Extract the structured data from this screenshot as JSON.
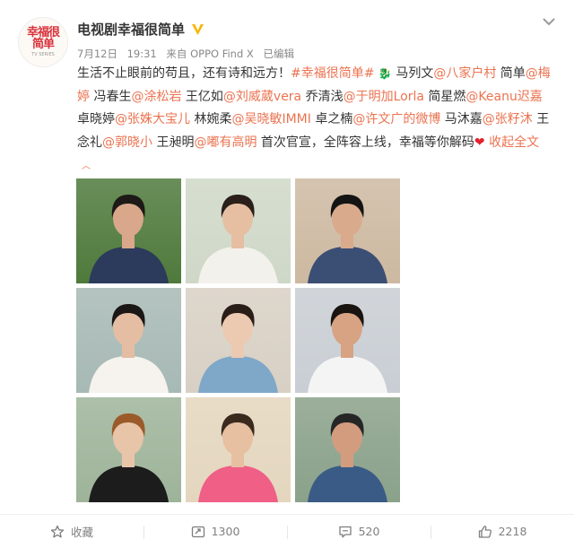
{
  "post": {
    "author": "电视剧幸福很简单",
    "avatar_text": "幸福很简单",
    "avatar_sub": "TV SERIES",
    "meta": {
      "date": "7月12日",
      "time": "19:31",
      "source": "来自 OPPO Find X",
      "edited": "已编辑"
    },
    "text_segments": [
      {
        "t": "生活不止眼前的苟且，还有诗和远方！",
        "link": false
      },
      {
        "t": "#幸福很简单#",
        "link": true
      },
      {
        "t": " ",
        "link": false
      },
      {
        "t": "🐉",
        "link": false,
        "emoji": true
      },
      {
        "t": " 马列文",
        "link": false
      },
      {
        "t": "@八家户村",
        "link": true
      },
      {
        "t": " 简单",
        "link": false
      },
      {
        "t": "@梅婷",
        "link": true
      },
      {
        "t": " 冯春生",
        "link": false
      },
      {
        "t": "@涂松岩",
        "link": true
      },
      {
        "t": " 王亿如",
        "link": false
      },
      {
        "t": "@刘威葳vera",
        "link": true
      },
      {
        "t": " 乔清浅",
        "link": false
      },
      {
        "t": "@于明加Lorla",
        "link": true
      },
      {
        "t": " 简星燃",
        "link": false
      },
      {
        "t": "@Keanu迟嘉",
        "link": true
      },
      {
        "t": " 卓晓婷",
        "link": false
      },
      {
        "t": "@张姝大宝儿",
        "link": true
      },
      {
        "t": " 林婉柔",
        "link": false
      },
      {
        "t": "@吴晓敏IMMI",
        "link": true
      },
      {
        "t": " 卓之楠",
        "link": false
      },
      {
        "t": "@许文广的微博",
        "link": true
      },
      {
        "t": " 马沐嘉",
        "link": false
      },
      {
        "t": "@张籽沐",
        "link": true
      },
      {
        "t": " 王念礼",
        "link": false
      },
      {
        "t": "@郭晓小",
        "link": true
      },
      {
        "t": " 王昶明",
        "link": false
      },
      {
        "t": "@嘟有高明",
        "link": true
      },
      {
        "t": " 首次官宣，全阵容上线，幸福等你解码",
        "link": false
      }
    ],
    "heart": "❤",
    "collapse_label": "收起全文",
    "collapse_icon": "^"
  },
  "photos": [
    {
      "name": "cast-photo-1",
      "bg": "#4f7a3c",
      "shirt": "#2c3a5c",
      "skin": "#d9a78a",
      "hair": "#1e1a18"
    },
    {
      "name": "cast-photo-2",
      "bg": "#cfd8c8",
      "shirt": "#f3f1ec",
      "skin": "#e6bfa3",
      "hair": "#2a1f1a"
    },
    {
      "name": "cast-photo-3",
      "bg": "#cdb9a1",
      "shirt": "#3b4e74",
      "skin": "#d9aa8c",
      "hair": "#141414"
    },
    {
      "name": "cast-photo-4",
      "bg": "#a7b9b5",
      "shirt": "#f6f3ee",
      "skin": "#e4bda2",
      "hair": "#1b1716"
    },
    {
      "name": "cast-photo-5",
      "bg": "#d8d0c4",
      "shirt": "#7fa7c8",
      "skin": "#ecc9b1",
      "hair": "#2a1e18"
    },
    {
      "name": "cast-photo-6",
      "bg": "#c9ced4",
      "shirt": "#f4f4f4",
      "skin": "#d8a383",
      "hair": "#1a1411"
    },
    {
      "name": "cast-photo-7",
      "bg": "#9eb49a",
      "shirt": "#1c1c1c",
      "skin": "#e8c4a8",
      "hair": "#9b5a2a"
    },
    {
      "name": "cast-photo-8",
      "bg": "#e4d6be",
      "shirt": "#ef5f86",
      "skin": "#e7bfa1",
      "hair": "#3a2a1e"
    },
    {
      "name": "cast-photo-9",
      "bg": "#8aa18a",
      "shirt": "#3a5b86",
      "skin": "#d39c7e",
      "hair": "#262626"
    }
  ],
  "actions": {
    "favorite_label": "收藏",
    "repost_count": "1300",
    "comment_count": "520",
    "like_count": "2218"
  },
  "icons": {
    "verified": "verified-v-icon",
    "dropdown": "chevron-down-icon",
    "favorite": "star-icon",
    "repost": "repost-icon",
    "comment": "comment-icon",
    "like": "thumbs-up-icon"
  },
  "colors": {
    "link": "#eb7350",
    "verified": "#f7b500",
    "heart": "#e0242e",
    "logo": "#d9323c"
  }
}
